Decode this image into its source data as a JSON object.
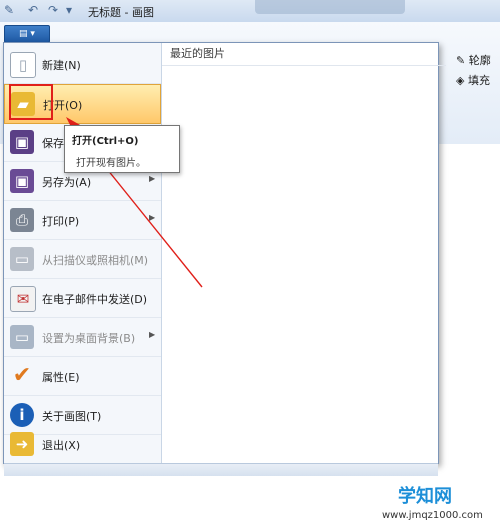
{
  "window": {
    "title": "无标题 - 画图",
    "qat_icons": [
      "paint-app-icon",
      "undo-icon",
      "redo-icon",
      "customize-icon"
    ]
  },
  "ribbon": {
    "outline_label": "轮廓",
    "fill_label": "填充"
  },
  "app_menu": {
    "button_icon": "menu-icon",
    "recent_heading": "最近的图片",
    "items": [
      {
        "label": "新建(N)",
        "icon": "new-document-icon",
        "submenu": false,
        "disabled": false,
        "highlighted": false
      },
      {
        "label": "打开(O)",
        "icon": "open-folder-icon",
        "submenu": false,
        "disabled": false,
        "highlighted": true
      },
      {
        "label": "保存(S)",
        "icon": "save-icon",
        "submenu": false,
        "disabled": false,
        "highlighted": false
      },
      {
        "label": "另存为(A)",
        "icon": "save-as-icon",
        "submenu": true,
        "disabled": false,
        "highlighted": false
      },
      {
        "label": "打印(P)",
        "icon": "printer-icon",
        "submenu": true,
        "disabled": false,
        "highlighted": false
      },
      {
        "label": "从扫描仪或照相机(M)",
        "icon": "scanner-icon",
        "submenu": false,
        "disabled": true,
        "highlighted": false
      },
      {
        "label": "在电子邮件中发送(D)",
        "icon": "email-icon",
        "submenu": false,
        "disabled": false,
        "highlighted": false
      },
      {
        "label": "设置为桌面背景(B)",
        "icon": "desktop-background-icon",
        "submenu": true,
        "disabled": true,
        "highlighted": false
      },
      {
        "label": "属性(E)",
        "icon": "properties-checkmark-icon",
        "submenu": false,
        "disabled": false,
        "highlighted": false
      },
      {
        "label": "关于画图(T)",
        "icon": "about-info-icon",
        "submenu": false,
        "disabled": false,
        "highlighted": false
      },
      {
        "label": "退出(X)",
        "icon": "exit-icon",
        "submenu": false,
        "disabled": false,
        "highlighted": false
      }
    ]
  },
  "tooltip": {
    "title": "打开(Ctrl+O)",
    "description": "打开现有图片。"
  },
  "watermark": {
    "title": "学知网",
    "site": "www.jmqz1000.com"
  },
  "colors": {
    "highlight": "#ffc86a",
    "annotation_red": "#e0201a",
    "app_button": "#1f5aa5"
  }
}
